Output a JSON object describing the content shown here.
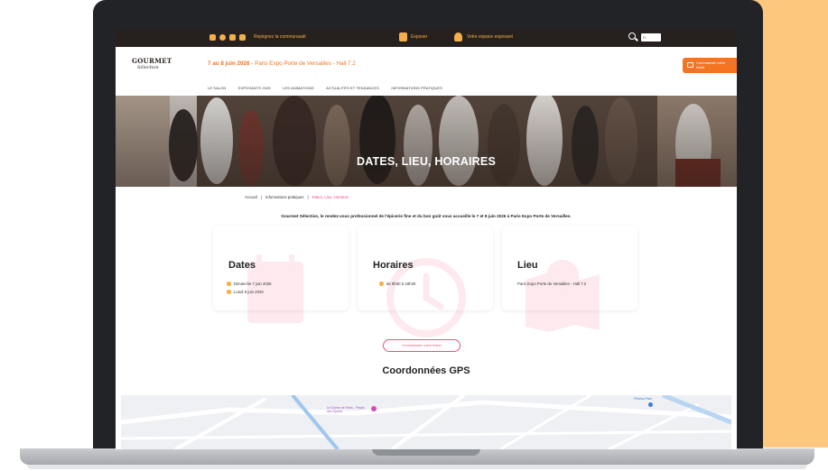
{
  "topbar": {
    "join_community": "Rejoignez la communauté",
    "exposer": "Exposer",
    "exhibitor_space": "Votre espace exposant",
    "language": "Fr"
  },
  "header": {
    "logo_line1": "GOURMET",
    "logo_line2": "Sélection",
    "dates_bold": "7 au 8 juin 2026",
    "dates_rest": " - Paris Expo Porte de Versailles - Hall 7.2",
    "nav": [
      "LE SALON",
      "EXPOSANTS 2025",
      "LES ANIMATIONS",
      "ACTUALITÉS ET TENDANCES",
      "INFORMATIONS PRATIQUES"
    ],
    "ticket_button": "Commander votre ticket"
  },
  "hero": {
    "title": "DATES, LIEU, HORAIRES"
  },
  "breadcrumb": {
    "home": "Accueil",
    "section": "Informations pratiques",
    "current": "Dates, Lieu, Horaires"
  },
  "intro": "Gourmet Sélection, le rendez-vous professionnel de l'épicerie fine et du bon goût vous accueille le 7 et 8 juin 2026 à Paris Expo Porte de Versailles.",
  "cards": {
    "dates": {
      "title": "Dates",
      "items": [
        "Dimanche 7 juin 2026",
        "Lundi 8 juin 2026"
      ]
    },
    "hours": {
      "title": "Horaires",
      "items": [
        "de 9h30 à 18h30"
      ]
    },
    "place": {
      "title": "Lieu",
      "text": "Paris Expo Porte de Versailles - Hall 7.2"
    }
  },
  "buy_button": "Commandez votre ticket",
  "gps_title": "Coordonnées GPS",
  "map": {
    "label_dome": "Le Dôme de Paris - Palais des Sports",
    "label_fitness": "Fitness Park"
  },
  "colors": {
    "accent_orange": "#f47421",
    "accent_pink": "#ef4f7a",
    "accent_yellow": "#f3b04a",
    "dark": "#26201e"
  }
}
